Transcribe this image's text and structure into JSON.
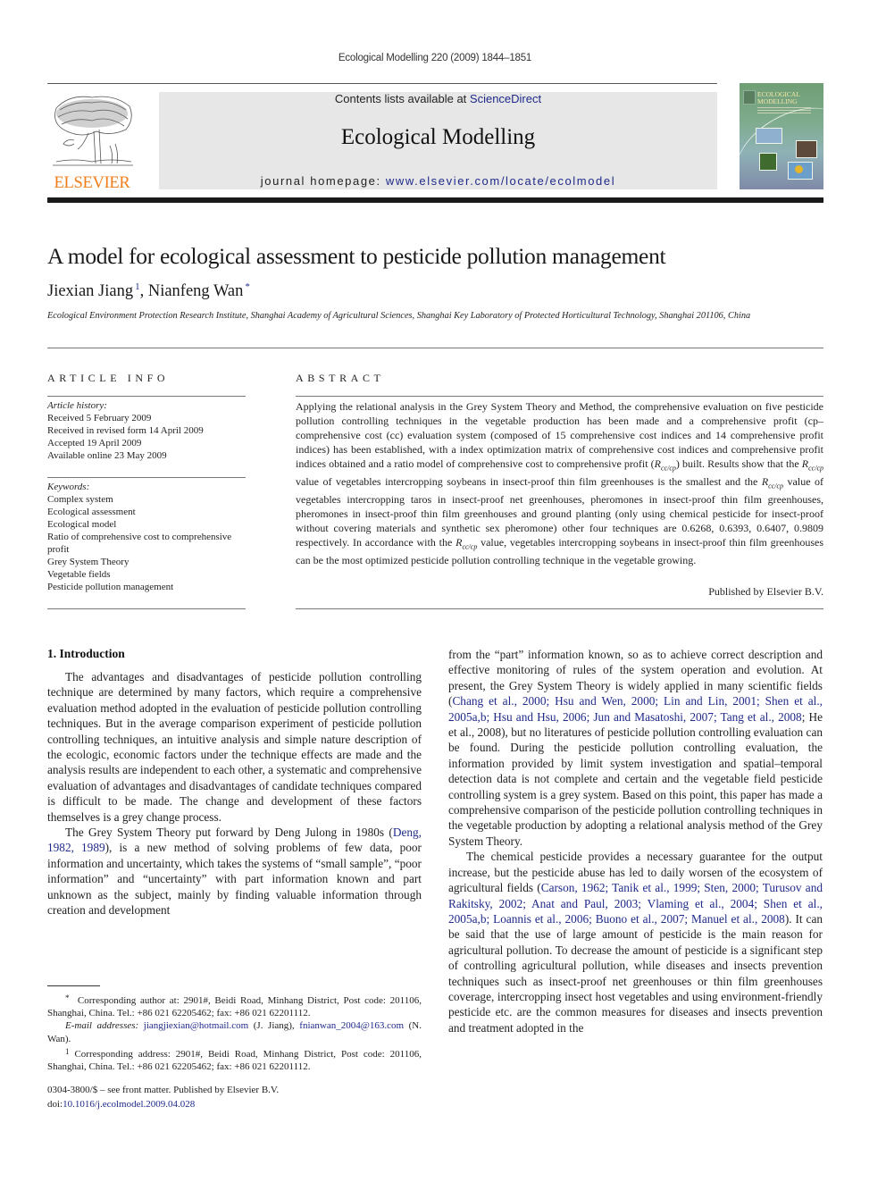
{
  "header": {
    "running_head": "Ecological Modelling 220 (2009) 1844–1851",
    "publisher_logo_text": "ELSEVIER",
    "contents_prefix": "Contents lists available at ",
    "contents_link": "ScienceDirect",
    "journal_title": "Ecological Modelling",
    "homepage_prefix": "journal homepage: ",
    "homepage_link": "www.elsevier.com/locate/ecolmodel",
    "cover_title_line1": "ECOLOGICAL",
    "cover_title_line2": "MODELLING",
    "colors": {
      "logo_orange": "#f07d1a",
      "link_blue": "#1f2a8a",
      "banner_grey": "#e7e7e7"
    }
  },
  "article": {
    "title": "A model for ecological assessment to pesticide pollution management",
    "authors": [
      {
        "name": "Jiexian Jiang",
        "mark": "1"
      },
      {
        "name": "Nianfeng Wan",
        "mark": "*"
      }
    ],
    "author_separator": ", ",
    "affiliation": "Ecological Environment Protection Research Institute, Shanghai Academy of Agricultural Sciences, Shanghai Key Laboratory of Protected Horticultural Technology, Shanghai 201106, China"
  },
  "article_info": {
    "heading": "ARTICLE INFO",
    "history_label": "Article history:",
    "history": [
      "Received 5 February 2009",
      "Received in revised form 14 April 2009",
      "Accepted 19 April 2009",
      "Available online 23 May 2009"
    ],
    "keywords_label": "Keywords:",
    "keywords": [
      "Complex system",
      "Ecological assessment",
      "Ecological model",
      "Ratio of comprehensive cost to comprehensive profit",
      "Grey System Theory",
      "Vegetable fields",
      "Pesticide pollution management"
    ]
  },
  "abstract": {
    "heading": "ABSTRACT",
    "parts": [
      "Applying the relational analysis in the Grey System Theory and Method, the comprehensive evaluation on five pesticide pollution controlling techniques in the vegetable production has been made and a comprehensive profit (cp–comprehensive cost (cc) evaluation system (composed of 15 comprehensive cost indices and 14 comprehensive profit indices) has been established, with a index optimization matrix of comprehensive cost indices and comprehensive profit indices obtained and a ratio model of comprehensive cost to comprehensive profit (",
      ") built. Results show that the ",
      " value of vegetables intercropping soybeans in insect-proof thin film greenhouses is the smallest and the ",
      " value of vegetables intercropping taros in insect-proof net greenhouses, pheromones in insect-proof thin film greenhouses, pheromones in insect-proof thin film greenhouses and ground planting (only using chemical pesticide for insect-proof without covering materials and synthetic sex pheromone) other four techniques are 0.6268, 0.6393, 0.6407, 0.9809 respectively. In accordance with the ",
      " value, vegetables intercropping soybeans in insect-proof thin film greenhouses can be the most optimized pesticide pollution controlling technique in the vegetable growing."
    ],
    "symbol_base": "R",
    "symbol_sub": "cc/cp",
    "published_by": "Published by Elsevier B.V."
  },
  "body": {
    "section_heading": "1.  Introduction",
    "left_p1": "The advantages and disadvantages of pesticide pollution controlling technique are determined by many factors, which require a comprehensive evaluation method adopted in the evaluation of pesticide pollution controlling techniques. But in the average comparison experiment of pesticide pollution controlling techniques, an intuitive analysis and simple nature description of the ecologic, economic factors under the technique effects are made and the analysis results are independent to each other, a systematic and comprehensive evaluation of advantages and disadvantages of candidate techniques compared is difficult to be made. The change and development of these factors themselves is a grey change process.",
    "left_p2_a": "The Grey System Theory put forward by Deng Julong in 1980s (",
    "left_p2_cite": "Deng, 1982, 1989",
    "left_p2_b": "), is a new method of solving problems of few data, poor information and uncertainty, which takes the systems of “small sample”, “poor information” and “uncertainty” with part information known and part unknown as the subject, mainly by finding valuable information through creation and development",
    "right_p1_a": "from the “part” information known, so as to achieve correct description and effective monitoring of rules of the system operation and evolution. At present, the Grey System Theory is widely applied in many scientific fields (",
    "right_p1_cites": "Chang et al., 2000; Hsu and Wen, 2000; Lin and Lin, 2001; Shen et al., 2005a,b; Hsu and Hsu, 2006; Jun and Masatoshi, 2007; Tang et al., 2008",
    "right_p1_b": "; He et al., 2008), but no literatures of pesticide pollution controlling evaluation can be found. During the pesticide pollution controlling evaluation, the information provided by limit system investigation and spatial–temporal detection data is not complete and certain and the vegetable field pesticide controlling system is a grey system. Based on this point, this paper has made a comprehensive comparison of the pesticide pollution controlling techniques in the vegetable production by adopting a relational analysis method of the Grey System Theory.",
    "right_p2_a": "The chemical pesticide provides a necessary guarantee for the output increase, but the pesticide abuse has led to daily worsen of the ecosystem of agricultural fields (",
    "right_p2_cites": "Carson, 1962; Tanik et al., 1999; Sten, 2000; Turusov and Rakitsky, 2002; Anat and Paul, 2003; Vlaming et al., 2004; Shen et al., 2005a,b; Loannis et al., 2006; Buono et al., 2007; Manuel et al., 2008",
    "right_p2_b": "). It can be said that the use of large amount of pesticide is the main reason for agricultural pollution. To decrease the amount of pesticide is a significant step of controlling agricultural pollution, while diseases and insects prevention techniques such as insect-proof net greenhouses or thin film greenhouses coverage, intercropping insect host vegetables and using environment-friendly pesticide etc. are the common measures for diseases and insects prevention and treatment adopted in the"
  },
  "footnotes": {
    "star_mark": "*",
    "star_text": "Corresponding author at: 2901#, Beidi Road, Minhang District, Post code: 201106, Shanghai, China. Tel.: +86 021 62205462; fax: +86 021 62201112.",
    "email_label": "E-mail addresses:",
    "email1": "jiangjiexian@hotmail.com",
    "email1_who": " (J. Jiang), ",
    "email2": "fnianwan_2004@163.com",
    "email2_who": " (N. Wan).",
    "one_mark": "1",
    "one_text": "Corresponding address: 2901#, Beidi Road, Minhang District, Post code: 201106, Shanghai, China. Tel.: +86 021 62205462; fax: +86 021 62201112."
  },
  "front_matter": {
    "issn_line": "0304-3800/$ – see front matter. Published by Elsevier B.V.",
    "doi_prefix": "doi:",
    "doi": "10.1016/j.ecolmodel.2009.04.028"
  }
}
